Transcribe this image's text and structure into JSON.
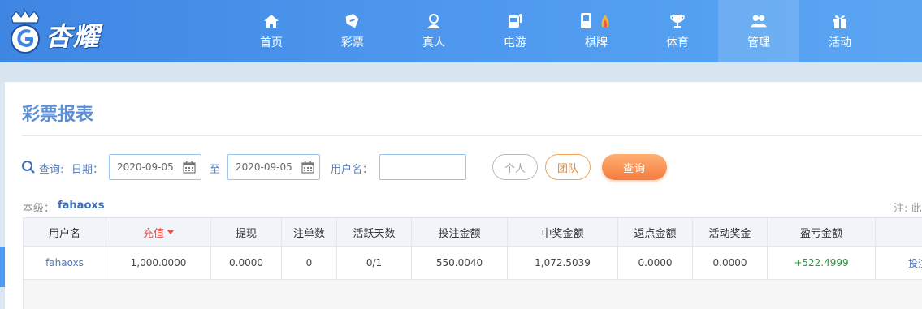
{
  "brand": {
    "name": "杏耀"
  },
  "nav": [
    {
      "label": "首页",
      "icon": "home-icon",
      "active": false
    },
    {
      "label": "彩票",
      "icon": "lottery-ticket-icon",
      "active": false
    },
    {
      "label": "真人",
      "icon": "dealer-icon",
      "active": false
    },
    {
      "label": "电游",
      "icon": "slot-machine-icon",
      "active": false
    },
    {
      "label": "棋牌",
      "icon": "mahjong-icon",
      "active": false
    },
    {
      "label": "体育",
      "icon": "trophy-icon",
      "active": false
    },
    {
      "label": "管理",
      "icon": "users-icon",
      "active": true
    },
    {
      "label": "活动",
      "icon": "gift-icon",
      "active": false
    }
  ],
  "page": {
    "title": "彩票报表"
  },
  "filter": {
    "query_label": "查询:",
    "date_label": "日期：",
    "start_date": "2020-09-05",
    "to_label": "至",
    "end_date": "2020-09-05",
    "username_label": "用户名：",
    "username_value": "",
    "personal_button": "个人",
    "team_button": "团队",
    "query_button": "查询"
  },
  "level": {
    "label": "本级：",
    "value": "fahaoxs"
  },
  "note": "注: 此",
  "table": {
    "headers": {
      "user": "用户名",
      "recharge": "充值",
      "withdraw": "提现",
      "bets": "注单数",
      "active_days": "活跃天数",
      "bet_amount": "投注金额",
      "win_amount": "中奖金额",
      "rebate": "返点金额",
      "bonus": "活动奖金",
      "profit": "盈亏金额"
    },
    "rows": [
      {
        "user": "fahaoxs",
        "recharge": "1,000.0000",
        "withdraw": "0.0000",
        "bets": "0",
        "active_days": "0/1",
        "bet_amount": "550.0040",
        "win_amount": "1,072.5039",
        "rebate": "0.0000",
        "bonus": "0.0000",
        "profit": "+522.4999",
        "action": "投注"
      }
    ]
  },
  "colors": {
    "accent": "#4e99ee",
    "profit": "#2a9a3a",
    "sort": "#e8504a",
    "query_button": "#f47b3f"
  }
}
